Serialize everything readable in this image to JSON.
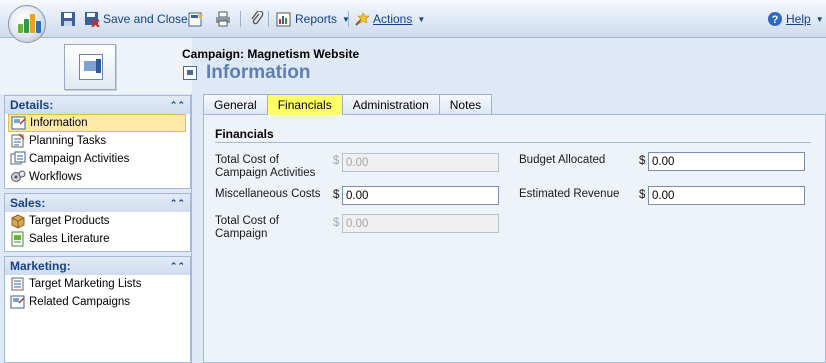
{
  "toolbar": {
    "save_and_close": "Save and Close",
    "reports": "Reports",
    "actions": "Actions",
    "help": "Help"
  },
  "header": {
    "record_title": "Campaign: Magnetism Website",
    "form_title": "Information"
  },
  "nav": {
    "details": {
      "heading": "Details:",
      "items": [
        "Information",
        "Planning Tasks",
        "Campaign Activities",
        "Workflows"
      ]
    },
    "sales": {
      "heading": "Sales:",
      "items": [
        "Target Products",
        "Sales Literature"
      ]
    },
    "marketing": {
      "heading": "Marketing:",
      "items": [
        "Target Marketing Lists",
        "Related Campaigns"
      ]
    }
  },
  "tabs": [
    "General",
    "Financials",
    "Administration",
    "Notes"
  ],
  "active_tab": "Financials",
  "form": {
    "section_title": "Financials",
    "currency_symbol": "$",
    "fields": {
      "total_cost_activities": {
        "label_line1": "Total Cost of",
        "label_line2": "Campaign Activities",
        "value": "0.00"
      },
      "misc_costs": {
        "label": "Miscellaneous Costs",
        "value": "0.00"
      },
      "total_cost_campaign": {
        "label_line1": "Total Cost of",
        "label_line2": "Campaign",
        "value": "0.00"
      },
      "budget_allocated": {
        "label": "Budget Allocated",
        "value": "0.00"
      },
      "estimated_revenue": {
        "label": "Estimated Revenue",
        "value": "0.00"
      }
    }
  },
  "colors": {
    "accent": "#15428b",
    "active_tab_highlight": "#ffff66",
    "selected_nav": "#ffe9a6",
    "form_title": "#5d80b3"
  }
}
